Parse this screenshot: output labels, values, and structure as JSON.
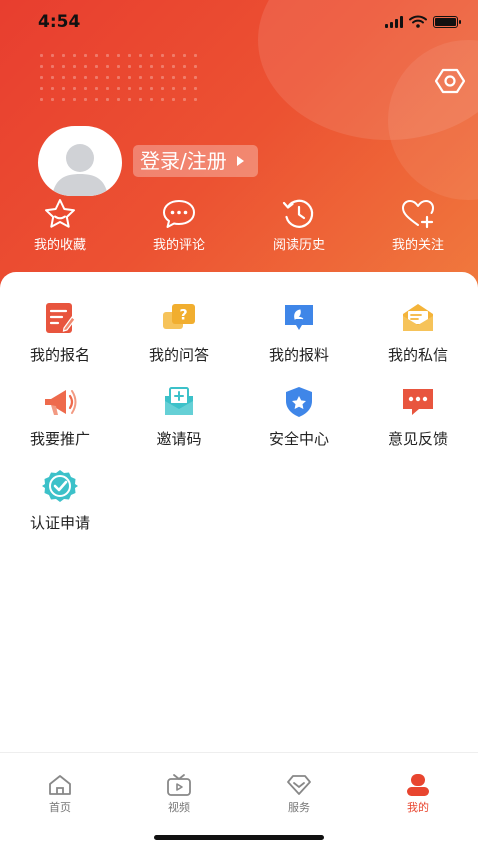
{
  "status_bar": {
    "time": "4:54"
  },
  "profile": {
    "login_label": "登录/注册"
  },
  "quick_links": [
    {
      "label": "我的收藏",
      "icon": "star-icon"
    },
    {
      "label": "我的评论",
      "icon": "comment-icon"
    },
    {
      "label": "阅读历史",
      "icon": "history-icon"
    },
    {
      "label": "我的关注",
      "icon": "heart-plus-icon"
    }
  ],
  "menu": [
    {
      "label": "我的报名",
      "icon": "signup-icon",
      "color": "#e8553e"
    },
    {
      "label": "我的问答",
      "icon": "qa-icon",
      "color": "#f1ae2f"
    },
    {
      "label": "我的报料",
      "icon": "report-icon",
      "color": "#3f86e8"
    },
    {
      "label": "我的私信",
      "icon": "message-icon",
      "color": "#f4b43a"
    },
    {
      "label": "我要推广",
      "icon": "megaphone-icon",
      "color": "#ee6a4c"
    },
    {
      "label": "邀请码",
      "icon": "invite-icon",
      "color": "#3cc1c9"
    },
    {
      "label": "安全中心",
      "icon": "shield-icon",
      "color": "#3f86e8"
    },
    {
      "label": "意见反馈",
      "icon": "feedback-icon",
      "color": "#e8553e"
    },
    {
      "label": "认证申请",
      "icon": "verify-icon",
      "color": "#3cc1c9"
    }
  ],
  "tabs": [
    {
      "label": "首页",
      "icon": "home-icon"
    },
    {
      "label": "视频",
      "icon": "tv-icon"
    },
    {
      "label": "服务",
      "icon": "service-icon"
    },
    {
      "label": "我的",
      "icon": "user-icon",
      "active": true
    }
  ],
  "colors": {
    "accent": "#e8452f",
    "header_start": "#e83e2f",
    "header_end": "#f07a3e"
  }
}
